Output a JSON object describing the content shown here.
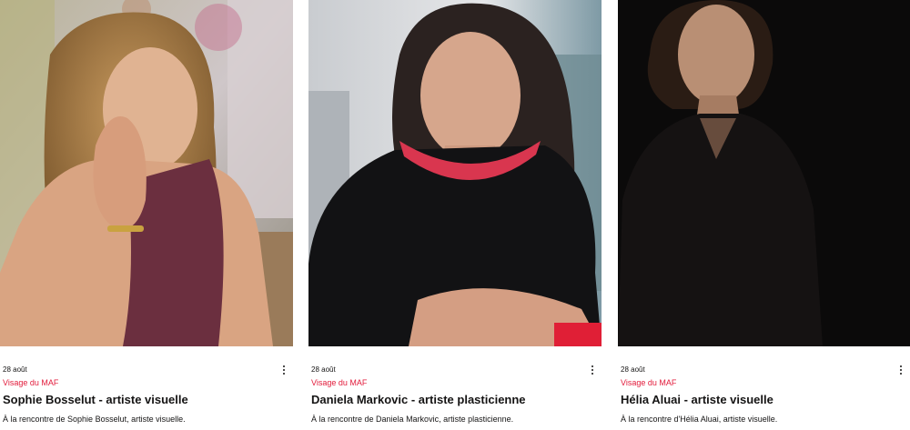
{
  "posts": [
    {
      "date": "28 août",
      "category": "Visage du MAF",
      "title": "Sophie Bosselut - artiste visuelle",
      "excerpt": "À la rencontre de Sophie Bosselut, artiste visuelle.",
      "more_icon": "three-dots-vertical"
    },
    {
      "date": "28 août",
      "category": "Visage du MAF",
      "title": "Daniela Markovic - artiste plasticienne",
      "excerpt": "À la rencontre de Daniela Markovic, artiste plasticienne.",
      "more_icon": "three-dots-vertical"
    },
    {
      "date": "28 août",
      "category": "Visage du MAF",
      "title": "Hélia Aluai - artiste visuelle",
      "excerpt": "À la rencontre d'Hélia Aluai, artiste visuelle.",
      "more_icon": "three-dots-vertical"
    }
  ],
  "colors": {
    "accent": "#e21b3b",
    "text": "#151414"
  }
}
